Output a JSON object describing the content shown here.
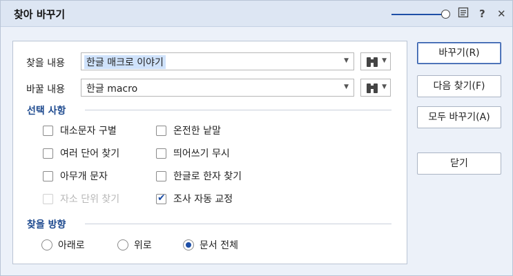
{
  "window": {
    "title": "찾아 바꾸기",
    "icons": {
      "slider": "slider-icon",
      "menu": "menu-icon",
      "help": "?",
      "close": "✕"
    }
  },
  "find": {
    "label": "찾을 내용",
    "value": "한글 매크로 이야기"
  },
  "replace": {
    "label": "바꿀 내용",
    "value": "한글 macro"
  },
  "options": {
    "title": "선택 사항",
    "items": [
      {
        "label": "대소문자 구별",
        "checked": false,
        "disabled": false
      },
      {
        "label": "온전한 낱말",
        "checked": false,
        "disabled": false
      },
      {
        "label": "여러 단어 찾기",
        "checked": false,
        "disabled": false
      },
      {
        "label": "띄어쓰기 무시",
        "checked": false,
        "disabled": false
      },
      {
        "label": "아무개 문자",
        "checked": false,
        "disabled": false
      },
      {
        "label": "한글로 한자 찾기",
        "checked": false,
        "disabled": false
      },
      {
        "label": "자소 단위 찾기",
        "checked": false,
        "disabled": true
      },
      {
        "label": "조사 자동 교정",
        "checked": true,
        "disabled": false
      }
    ]
  },
  "direction": {
    "title": "찾을 방향",
    "options": [
      {
        "label": "아래로",
        "selected": false
      },
      {
        "label": "위로",
        "selected": false
      },
      {
        "label": "문서 전체",
        "selected": true
      }
    ]
  },
  "buttons": {
    "replace": "바꾸기(R)",
    "find_next": "다음 찾기(F)",
    "replace_all": "모두 바꾸기(A)",
    "close": "닫기"
  },
  "colors": {
    "accent": "#1e4fa7",
    "section": "#1e4a8f",
    "titlebar": "#dde6f3"
  }
}
